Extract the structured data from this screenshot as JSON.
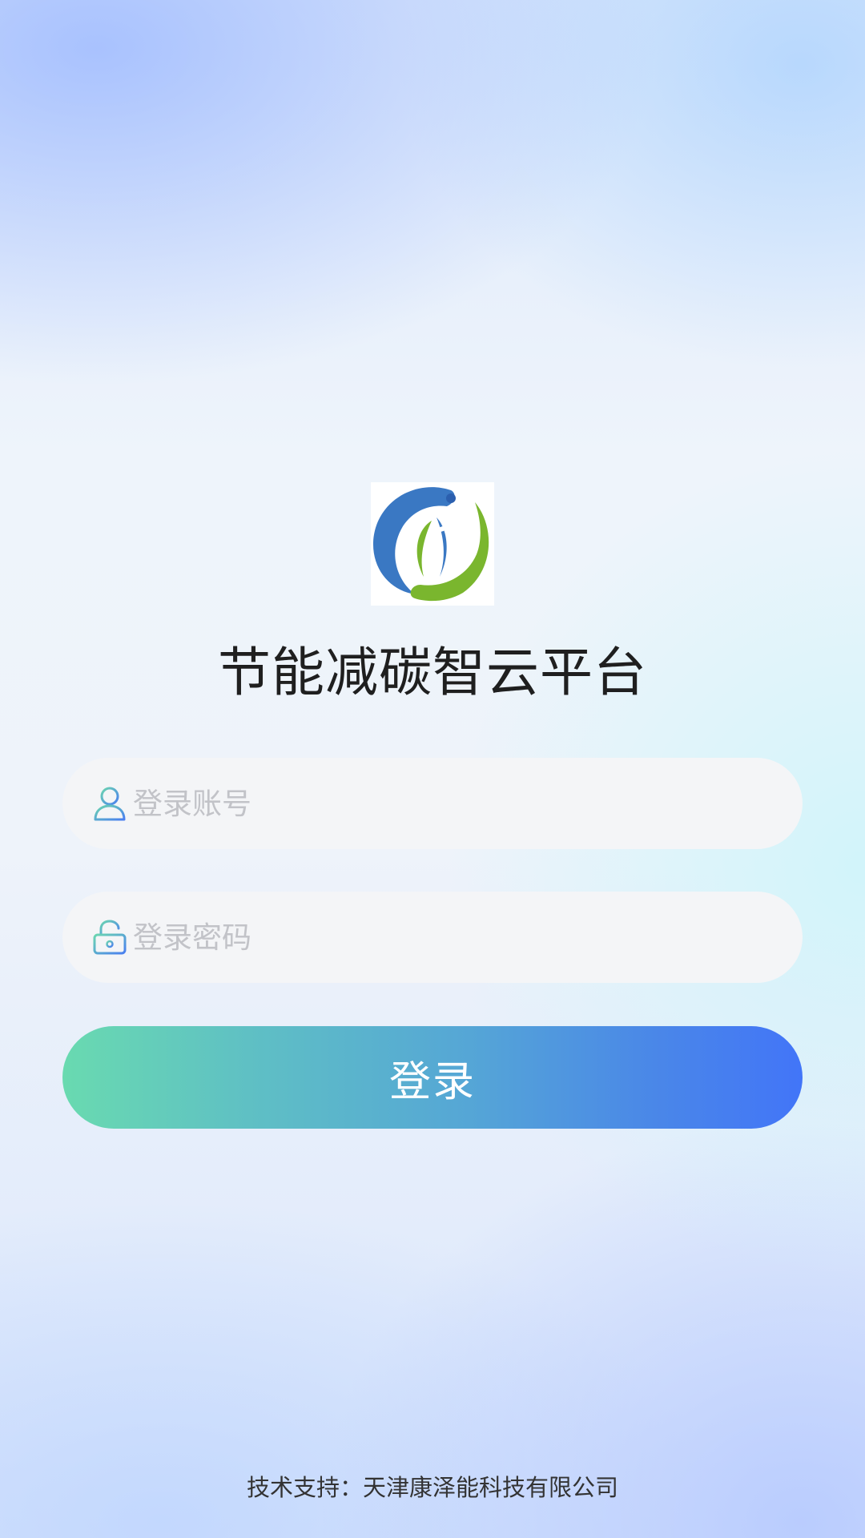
{
  "app": {
    "title": "节能减碳智云平台",
    "logo_icon": "leaf-ring-logo"
  },
  "login_form": {
    "account": {
      "icon": "user-icon",
      "placeholder": "登录账号",
      "value": ""
    },
    "password": {
      "icon": "lock-icon",
      "placeholder": "登录密码",
      "value": ""
    },
    "submit_label": "登录"
  },
  "footer": {
    "text": "技术支持：天津康泽能科技有限公司"
  },
  "colors": {
    "logo_blue": "#3a78c3",
    "logo_green": "#7ab62e",
    "button_start": "#69dab0",
    "button_end": "#4275f8",
    "field_bg": "#f4f5f7",
    "placeholder": "#c2c3c8"
  }
}
